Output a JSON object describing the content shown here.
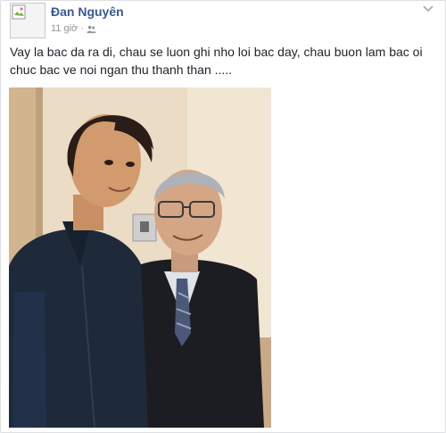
{
  "post": {
    "author": "Đan Nguyên",
    "timestamp": "11 giờ",
    "separator": "·",
    "privacy_icon": "friends-icon",
    "menu_icon": "chevron-down-icon",
    "text_line1": "Vay la bac da ra di, chau se luon ghi nho loi bac day, chau buon lam bac oi",
    "text_line2": "chuc bac ve noi ngan thu thanh than .....",
    "avatar_icon": "broken-image-icon",
    "photo_icon": "photo"
  },
  "colors": {
    "link": "#365899",
    "meta": "#90949c",
    "text": "#1d2129"
  }
}
